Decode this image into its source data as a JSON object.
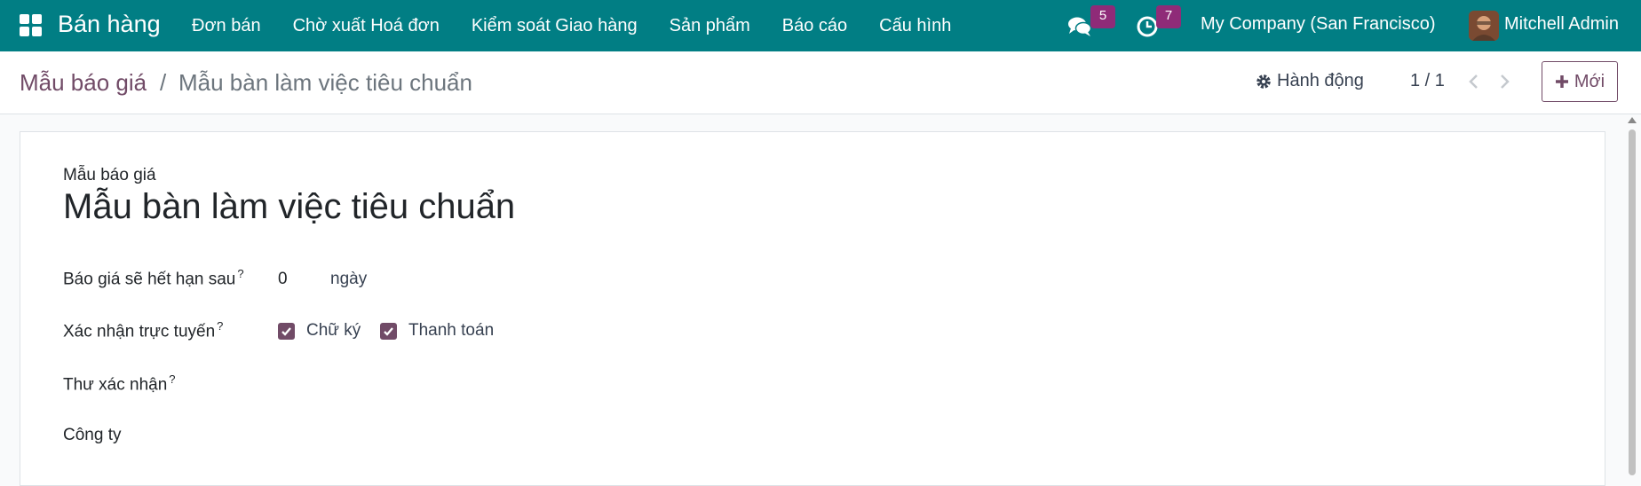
{
  "topbar": {
    "app_title": "Bán hàng",
    "menu": [
      "Đơn bán",
      "Chờ xuất Hoá đơn",
      "Kiểm soát Giao hàng",
      "Sản phẩm",
      "Báo cáo",
      "Cấu hình"
    ],
    "messages_count": "5",
    "activities_count": "7",
    "company": "My Company (San Francisco)",
    "user": "Mitchell Admin",
    "icons": [
      "apps-grid-icon",
      "chat-icon",
      "clock-icon"
    ]
  },
  "controlbar": {
    "breadcrumb_parent": "Mẫu báo giá",
    "breadcrumb_separator": "/",
    "breadcrumb_current": "Mẫu bàn làm việc tiêu chuẩn",
    "action_label": "Hành động",
    "pager": "1 / 1",
    "new_label": "Mới"
  },
  "form": {
    "record_type": "Mẫu báo giá",
    "name": "Mẫu bàn làm việc tiêu chuẩn",
    "fields": {
      "expiry_label": "Báo giá sẽ hết hạn sau",
      "expiry_value": "0",
      "expiry_unit": "ngày",
      "online_label": "Xác nhận trực tuyến",
      "signature_label": "Chữ ký",
      "payment_label": "Thanh toán",
      "confirmation_mail_label": "Thư xác nhận",
      "company_label": "Công ty",
      "help_mark": "?"
    }
  },
  "colors": {
    "topbar": "#017e84",
    "brand": "#714b67",
    "badge": "#8f2b78"
  }
}
